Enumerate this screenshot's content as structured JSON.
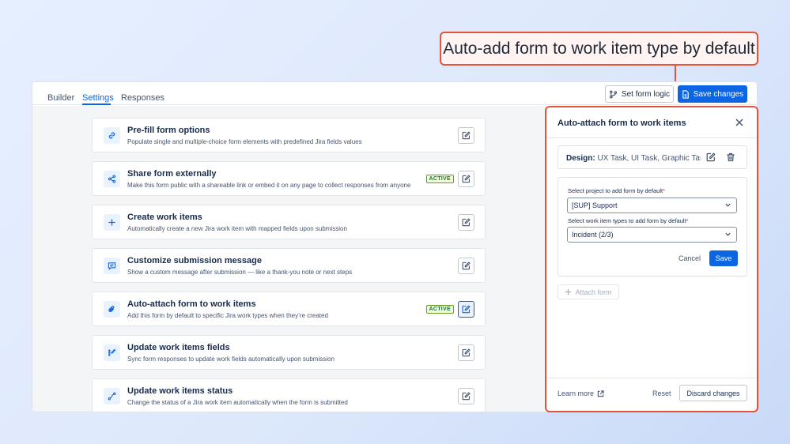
{
  "callout": {
    "text": "Auto-add form to work item type by default"
  },
  "tabs": [
    {
      "label": "Builder",
      "active": false
    },
    {
      "label": "Settings",
      "active": true
    },
    {
      "label": "Responses",
      "active": false
    }
  ],
  "toolbar": {
    "form_logic_label": "Set form logic",
    "save_changes_label": "Save changes"
  },
  "settings": [
    {
      "title": "Pre-fill form options",
      "description": "Populate single and multiple-choice form elements with predefined Jira fields values",
      "badge": "",
      "icon": "link-icon"
    },
    {
      "title": "Share form externally",
      "description": "Make this form public with a shareable link or embed it on any page to collect responses from anyone",
      "badge": "ACTIVE",
      "icon": "share-icon"
    },
    {
      "title": "Create work items",
      "description": "Automatically create a new Jira work item with mapped fields upon submission",
      "badge": "",
      "icon": "plus-icon"
    },
    {
      "title": "Customize submission message",
      "description": "Show a custom message after submission — like a thank-you note or next steps",
      "badge": "",
      "icon": "message-icon"
    },
    {
      "title": "Auto-attach form to work items",
      "description": "Add this form by default to specific Jira work types when they’re created",
      "badge": "ACTIVE",
      "icon": "attachment-icon"
    },
    {
      "title": "Update work items fields",
      "description": "Sync form responses to update work fields automatically upon submission",
      "badge": "",
      "icon": "fields-icon"
    },
    {
      "title": "Update work items status",
      "description": "Change the status of a Jira work item automatically when the form is submitted",
      "badge": "",
      "icon": "status-icon"
    }
  ],
  "panel": {
    "title": "Auto-attach form to work items",
    "design_label": "Design:",
    "design_value": "UX Task, UI Task, Graphic Tas...",
    "project_label": "Select project to add form by default",
    "project_value": "[SUP] Support",
    "types_label": "Select work item types to add form by default",
    "types_value": "Incident (2/3)",
    "required_mark": "*",
    "cancel_label": "Cancel",
    "save_label": "Save",
    "attach_label": "Attach form",
    "learn_more_label": "Learn more",
    "reset_label": "Reset",
    "discard_label": "Discard changes"
  },
  "colors": {
    "accent": "#0c66e4",
    "highlight": "#e5533c",
    "active_badge_bg": "#efffd6",
    "active_badge_text": "#216e4e"
  }
}
